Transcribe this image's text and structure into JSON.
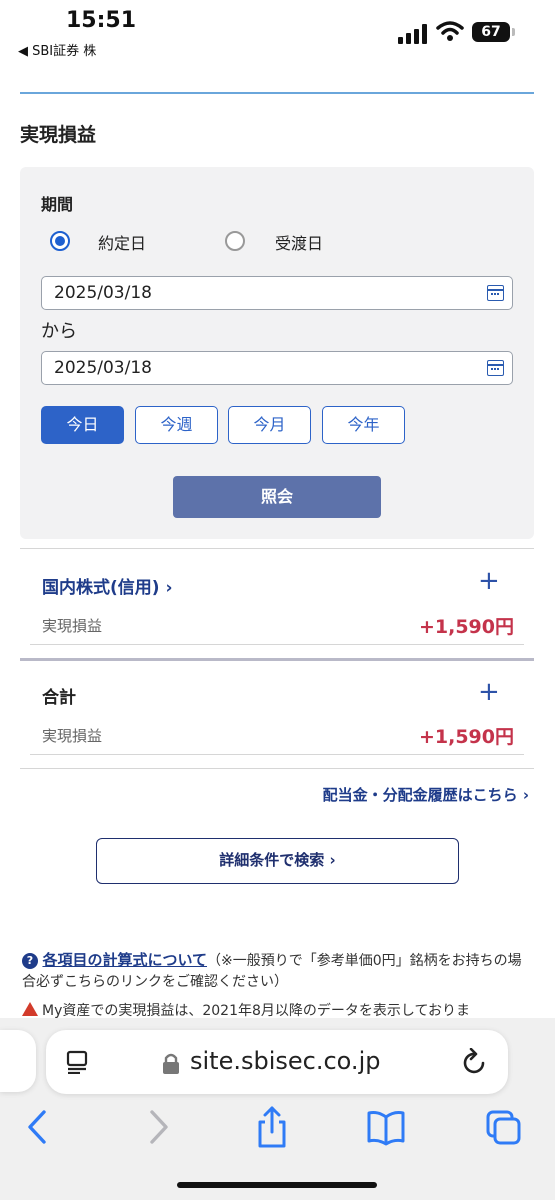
{
  "status_bar": {
    "time": "15:51",
    "back_label": "◀ SBI証券 株",
    "battery": "67"
  },
  "section_title": "実現損益",
  "filter": {
    "period_label": "期間",
    "radio_options": [
      {
        "label": "約定日",
        "selected": true
      },
      {
        "label": "受渡日",
        "selected": false
      }
    ],
    "from_date": "2025/03/18",
    "kara": "から",
    "to_date": "2025/03/18",
    "quick_buttons": [
      {
        "label": "今日",
        "active": true
      },
      {
        "label": "今週",
        "active": false
      },
      {
        "label": "今月",
        "active": false
      },
      {
        "label": "今年",
        "active": false
      }
    ],
    "inquiry_button": "照会"
  },
  "groups": [
    {
      "title": "国内株式(信用) ›",
      "row_label": "実現損益",
      "row_value": "+1,590円"
    },
    {
      "title": "合計",
      "row_label": "実現損益",
      "row_value": "+1,590円"
    }
  ],
  "dividend_link": "配当金・分配金履歴はこちら ›",
  "search_button": "詳細条件で検索 ›",
  "notes": {
    "formula_link": "各項目の計算式について",
    "formula_note": "（※一般預りで「参考単価0円」銘柄をお持ちの場合必ずこちらのリンクをご確認ください）",
    "warning": "My資産での実現損益は、2021年8月以降のデータを表示しておりま"
  },
  "browser": {
    "url": "site.sbisec.co.jp"
  },
  "colors": {
    "accent": "#2d63c8",
    "profit": "#c4334b",
    "link": "#1f3c8a",
    "inquiry": "#5d72aa"
  }
}
